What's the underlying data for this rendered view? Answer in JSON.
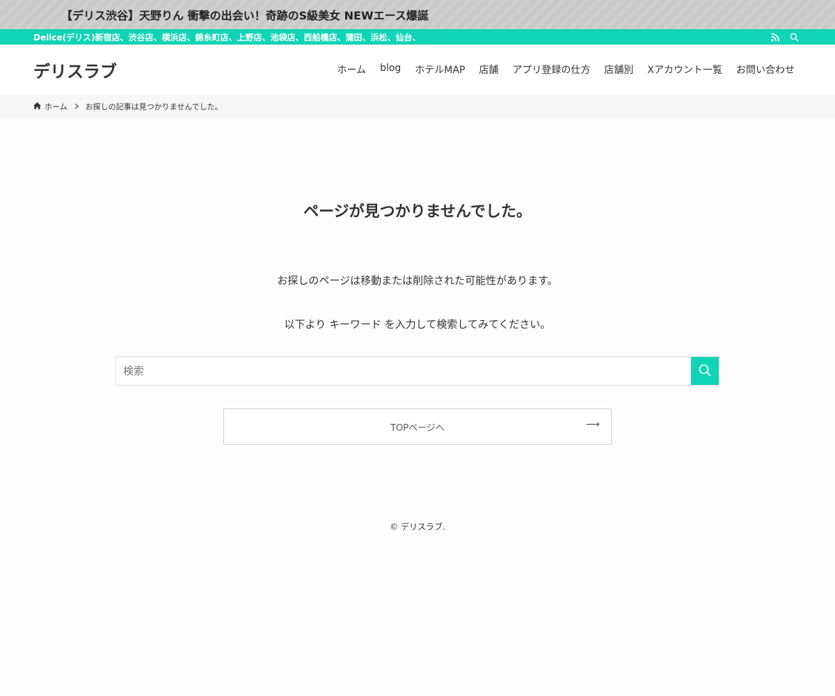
{
  "notice": {
    "text": "【デリス渋谷】天野りん 衝撃の出会い！奇跡のS級美女 NEWエース爆誕"
  },
  "top_bar": {
    "text": "Delice(デリス)新宿店、渋谷店、横浜店、錦糸町店、上野店、池袋店、西船橋店、蒲田、浜松、仙台、",
    "bg_color": "#11d4b6"
  },
  "header": {
    "site_title": "デリスラブ",
    "nav": [
      {
        "label": "ホーム"
      },
      {
        "label": "blog"
      },
      {
        "label": "ホテルMAP"
      },
      {
        "label": "店舗"
      },
      {
        "label": "アプリ登録の仕方"
      },
      {
        "label": "店舗別"
      },
      {
        "label": "Xアカウント一覧"
      },
      {
        "label": "お問い合わせ"
      }
    ]
  },
  "breadcrumb": {
    "home": "ホーム",
    "current": "お探しの記事は見つかりませんでした。"
  },
  "main": {
    "title": "ページが見つかりませんでした。",
    "message1": "お探しのページは移動または削除された可能性があります。",
    "message2": "以下より キーワード を入力して検索してみてください。",
    "search_placeholder": "検索",
    "top_link_label": "TOPページへ",
    "top_link_arrow": "⟶"
  },
  "footer": {
    "copyright": "© デリスラブ."
  },
  "icons": {
    "rss": "rss-icon",
    "search": "search-icon",
    "home": "home-icon",
    "chevron": "chevron-right-icon"
  }
}
